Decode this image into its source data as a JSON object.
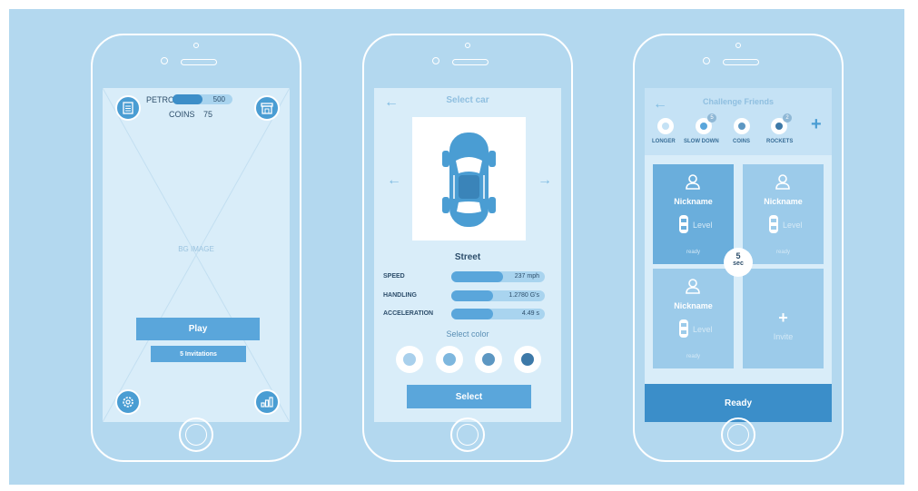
{
  "screen1": {
    "petrol_label": "PETROL",
    "petrol_value": "500",
    "petrol_level": 0.5,
    "coins_label": "COINS",
    "coins_value": "75",
    "bg_label": "BG IMAGE",
    "play_label": "Play",
    "invitations_label": "5 Invitations",
    "icons": [
      "document-icon",
      "shop-icon",
      "settings-icon",
      "leaderboard-icon"
    ]
  },
  "screen2": {
    "title": "Select car",
    "car_name": "Street",
    "stats": [
      {
        "label": "SPEED",
        "value": "237 mph",
        "level": 0.55
      },
      {
        "label": "HANDLING",
        "value": "1.2780 G's",
        "level": 0.45
      },
      {
        "label": "ACCELERATION",
        "value": "4.49 s",
        "level": 0.45
      }
    ],
    "select_color_label": "Select color",
    "swatches": [
      "#a9d0ec",
      "#7eb7de",
      "#5d97c2",
      "#3d79a8"
    ],
    "select_label": "Select"
  },
  "screen3": {
    "title": "Challenge Friends",
    "powerups": [
      {
        "label": "LONGER",
        "badge": ""
      },
      {
        "label": "SLOW DOWN",
        "badge": "5"
      },
      {
        "label": "COINS",
        "badge": ""
      },
      {
        "label": "ROCKETS",
        "badge": "2"
      }
    ],
    "players": [
      {
        "name": "Nickname",
        "level": "Level",
        "status": "ready"
      },
      {
        "name": "Nickname",
        "level": "Level",
        "status": "ready"
      },
      {
        "name": "Nickname",
        "level": "Level",
        "status": "ready"
      }
    ],
    "invite_label": "Invite",
    "timer_value": "5",
    "timer_unit": "sec",
    "ready_label": "Ready"
  },
  "colors": {
    "background": "#b3d8ef",
    "screen": "#d9edf9",
    "accent": "#5aa6db",
    "accent_dark": "#3b8ec9",
    "text": "#2d4e6b"
  }
}
